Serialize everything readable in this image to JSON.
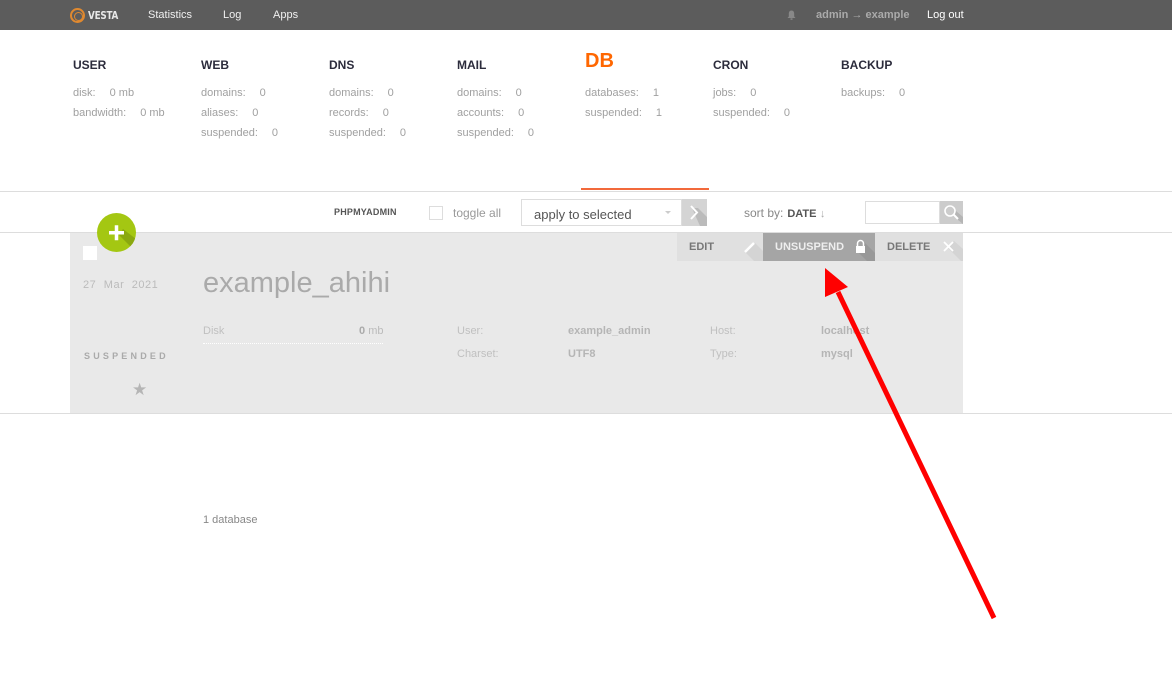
{
  "topbar": {
    "logo_text": "VESTA",
    "nav": [
      "Statistics",
      "Log",
      "Apps"
    ],
    "user": "admin → example",
    "logout": "Log out"
  },
  "stats": [
    {
      "title": "USER",
      "active": false,
      "rows": [
        {
          "label": "disk:",
          "value": "0 mb"
        },
        {
          "label": "bandwidth:",
          "value": "0 mb"
        }
      ]
    },
    {
      "title": "WEB",
      "active": false,
      "rows": [
        {
          "label": "domains:",
          "value": "0"
        },
        {
          "label": "aliases:",
          "value": "0"
        },
        {
          "label": "suspended:",
          "value": "0"
        }
      ]
    },
    {
      "title": "DNS",
      "active": false,
      "rows": [
        {
          "label": "domains:",
          "value": "0"
        },
        {
          "label": "records:",
          "value": "0"
        },
        {
          "label": "suspended:",
          "value": "0"
        }
      ]
    },
    {
      "title": "MAIL",
      "active": false,
      "rows": [
        {
          "label": "domains:",
          "value": "0"
        },
        {
          "label": "accounts:",
          "value": "0"
        },
        {
          "label": "suspended:",
          "value": "0"
        }
      ]
    },
    {
      "title": "DB",
      "active": true,
      "rows": [
        {
          "label": "databases:",
          "value": "1"
        },
        {
          "label": "suspended:",
          "value": "1"
        }
      ]
    },
    {
      "title": "CRON",
      "active": false,
      "rows": [
        {
          "label": "jobs:",
          "value": "0"
        },
        {
          "label": "suspended:",
          "value": "0"
        }
      ]
    },
    {
      "title": "BACKUP",
      "active": false,
      "rows": [
        {
          "label": "backups:",
          "value": "0"
        }
      ]
    }
  ],
  "toolbar": {
    "phpmyadmin": "PHPMYADMIN",
    "toggle_all": "toggle all",
    "apply_select": "apply to selected",
    "sort_by_label": "sort by:",
    "sort_by_value": "DATE",
    "sort_arrow": "↓",
    "search_value": ""
  },
  "colors": {
    "accent": "#ff6701",
    "add_button": "#a4c712",
    "topbar": "#5c5c5c",
    "annotation_arrow": "#ff0000"
  },
  "database": {
    "date": "27 Mar 2021",
    "status": "SUSPENDED",
    "name": "example_ahihi",
    "disk_label": "Disk",
    "disk_value": "0",
    "disk_unit": "mb",
    "user_label": "User:",
    "user_value": "example_admin",
    "charset_label": "Charset:",
    "charset_value": "UTF8",
    "host_label": "Host:",
    "host_value": "localhost",
    "type_label": "Type:",
    "type_value": "mysql",
    "actions": {
      "edit": "EDIT",
      "unsuspend": "UNSUSPEND",
      "delete": "DELETE"
    }
  },
  "footer": {
    "count": "1 database"
  }
}
